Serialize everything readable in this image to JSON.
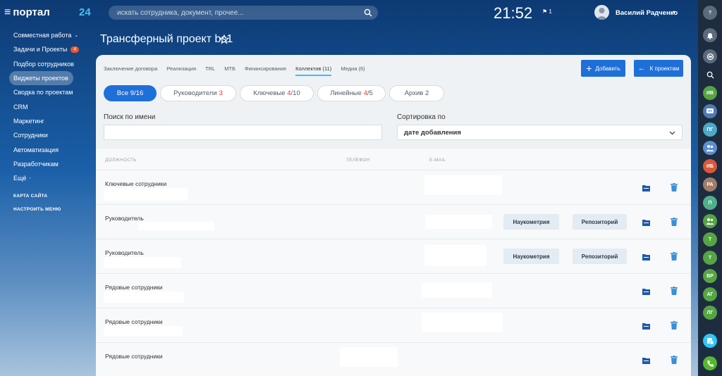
{
  "header": {
    "logo_text": "портал",
    "logo_num": "24",
    "search_placeholder": "искать сотрудника, документ, прочее...",
    "time": "21:52",
    "flag_count": "1",
    "user_name": "Василий Радченко"
  },
  "menu": {
    "items": [
      {
        "label": "Совместная работа",
        "has_caret": true
      },
      {
        "label": "Задачи и Проекты",
        "badge": "4"
      },
      {
        "label": "Подбор сотрудников"
      },
      {
        "label": "Виджеты проектов",
        "active": true
      },
      {
        "label": "Сводка по проектам"
      },
      {
        "label": "CRM"
      },
      {
        "label": "Маркетинг"
      },
      {
        "label": "Сотрудники"
      },
      {
        "label": "Автоматизация"
      },
      {
        "label": "Разработчикам"
      },
      {
        "label": "Ещё",
        "has_caret": true
      }
    ],
    "sitemap": "КАРТА САЙТА",
    "settings": "НАСТРОИТЬ МЕНЮ"
  },
  "rightbar": {
    "buttons": [
      {
        "icon": "help-icon",
        "color": "#5c6b7c"
      },
      {
        "icon": "bell-icon",
        "color": "#5c6b7c"
      },
      {
        "icon": "open-lines-icon",
        "color": "#5c6b7c"
      },
      {
        "icon": "search-icon",
        "color": "transparent"
      },
      {
        "label": "ИВ",
        "color": "#56a544"
      },
      {
        "icon": "group-chat-icon",
        "color": "#4e7bb5"
      },
      {
        "label": "ПГ",
        "color": "#4ea8c9"
      },
      {
        "icon": "users-icon",
        "color": "#5d8fd0"
      },
      {
        "label": "ИБ",
        "color": "#d8593a"
      },
      {
        "label": "РА",
        "color": "#a07c6a"
      },
      {
        "label": "П",
        "color": "#4fb08a"
      },
      {
        "icon": "users-icon",
        "color": "#56a544"
      },
      {
        "label": "Т",
        "color": "#56a544"
      },
      {
        "label": "Т",
        "color": "#56a544"
      },
      {
        "label": "ВР",
        "color": "#56a544"
      },
      {
        "label": "АГ",
        "color": "#56a544"
      },
      {
        "label": "ЛГ",
        "color": "#56a544"
      },
      {
        "icon": "add-chat-icon",
        "color": "#2fc6f6"
      },
      {
        "icon": "phone-icon",
        "color": "#56b82e"
      }
    ]
  },
  "page": {
    "title": "Трансферный проект bs1"
  },
  "tabs": [
    {
      "label": "Заключение договора"
    },
    {
      "label": "Реализация"
    },
    {
      "label": "TRL"
    },
    {
      "label": "МТБ"
    },
    {
      "label": "Финансирование"
    },
    {
      "label": "Коллектив (11)",
      "active": true
    },
    {
      "label": "Медиа (6)"
    }
  ],
  "actions": {
    "add_label": "Добавить",
    "back_label": "К проектам"
  },
  "filters": [
    {
      "label": "Все 9/16",
      "active": true
    },
    {
      "label": "Руководители",
      "count_red": "3"
    },
    {
      "label": "Ключевые",
      "count_red": "4",
      "count_rest": "/10"
    },
    {
      "label": "Линейные",
      "count_red": "4",
      "count_rest": "/5"
    },
    {
      "label": "Архив 2"
    }
  ],
  "search_by_name": {
    "label": "Поиск по имени",
    "value": ""
  },
  "sort": {
    "label": "Сортировка по",
    "value": "дате добавления"
  },
  "table": {
    "headers": {
      "position": "ДОЛЖНОСТЬ",
      "phone": "ТЕЛЕФОН",
      "email": "E-MAIL"
    },
    "rows": [
      {
        "role": "Ключевые сотрудники",
        "buttons": false
      },
      {
        "role": "Руководитель",
        "buttons": true
      },
      {
        "role": "Руководитель",
        "buttons": true
      },
      {
        "role": "Рядовые сотрудники",
        "buttons": false
      },
      {
        "role": "Рядовые сотрудники",
        "buttons": false
      },
      {
        "role": "Рядовые сотрудники",
        "buttons": false
      }
    ],
    "btn_science": "Наукометрия",
    "btn_repo": "Репозиторий"
  }
}
